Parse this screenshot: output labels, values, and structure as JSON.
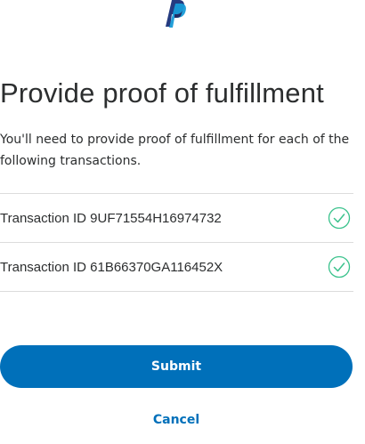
{
  "header": {
    "logo_icon": "paypal-logo-icon",
    "brand_colors": [
      "#253b80",
      "#179bd7",
      "#222d65"
    ]
  },
  "page": {
    "title": "Provide proof of fulfillment",
    "intro": "You'll need to provide proof of fulfillment for each of the following transactions."
  },
  "transactions": [
    {
      "label": "Transaction ID 9UF71554H16974732",
      "status_icon": "check-circle-icon"
    },
    {
      "label": "Transaction ID 61B66370GA116452X",
      "status_icon": "check-circle-icon"
    }
  ],
  "actions": {
    "submit_label": "Submit",
    "cancel_label": "Cancel"
  },
  "colors": {
    "accent": "#0070ba",
    "check": "#3ac28c",
    "divider": "#dcdcdc",
    "text": "#2c2e2f"
  }
}
